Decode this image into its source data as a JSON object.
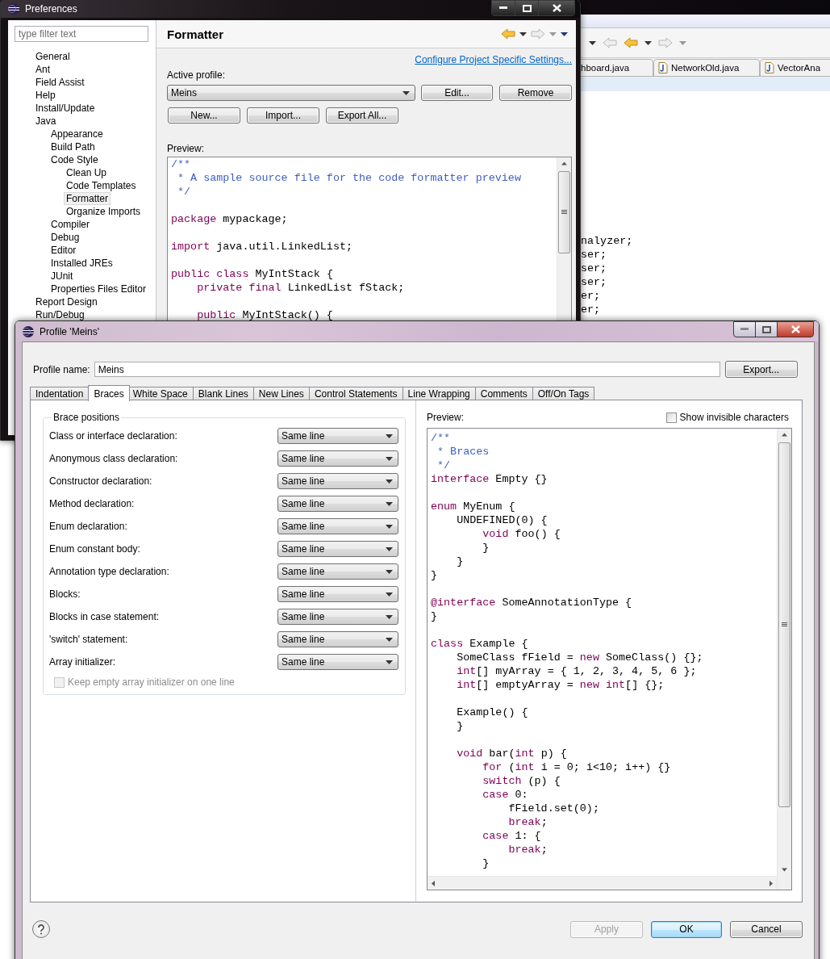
{
  "ide_background": {
    "editor_tabs": [
      {
        "label": "hboard.java",
        "selected": false
      },
      {
        "label": "NetworkOld.java",
        "selected": false
      },
      {
        "label": "VectorAna",
        "selected": false
      }
    ],
    "code_lines": [
      "nalyzer;",
      "ser;",
      "ser;",
      "ser;",
      "er;",
      "er;"
    ]
  },
  "preferences": {
    "title": "Preferences",
    "filter_placeholder": "type filter text",
    "tree": [
      {
        "label": "General",
        "selected": false
      },
      {
        "label": "Ant",
        "selected": false
      },
      {
        "label": "Field Assist",
        "selected": false
      },
      {
        "label": "Help",
        "selected": false
      },
      {
        "label": "Install/Update",
        "selected": false
      },
      {
        "label": "Java",
        "selected": false,
        "children": [
          {
            "label": "Appearance",
            "selected": false
          },
          {
            "label": "Build Path",
            "selected": false
          },
          {
            "label": "Code Style",
            "selected": false,
            "children": [
              {
                "label": "Clean Up",
                "selected": false
              },
              {
                "label": "Code Templates",
                "selected": false
              },
              {
                "label": "Formatter",
                "selected": true
              },
              {
                "label": "Organize Imports",
                "selected": false
              }
            ]
          },
          {
            "label": "Compiler",
            "selected": false
          },
          {
            "label": "Debug",
            "selected": false
          },
          {
            "label": "Editor",
            "selected": false
          },
          {
            "label": "Installed JREs",
            "selected": false
          },
          {
            "label": "JUnit",
            "selected": false
          },
          {
            "label": "Properties Files Editor",
            "selected": false
          }
        ]
      },
      {
        "label": "Report Design",
        "selected": false
      },
      {
        "label": "Run/Debug",
        "selected": false
      }
    ],
    "page_title": "Formatter",
    "link": "Configure Project Specific Settings...",
    "active_profile_label": "Active profile:",
    "active_profile": "Meins",
    "profile_actions": [
      "Edit...",
      "Remove"
    ],
    "profile_buttons": [
      "New...",
      "Import...",
      "Export All..."
    ],
    "preview_label": "Preview:",
    "preview_lines": [
      {
        "kind": "comment",
        "text": "/**"
      },
      {
        "kind": "comment",
        "text": " * A sample source file for the code formatter preview"
      },
      {
        "kind": "comment",
        "text": " */"
      },
      {
        "kind": "blank"
      },
      {
        "kind": "code",
        "text": "**package** mypackage;"
      },
      {
        "kind": "blank"
      },
      {
        "kind": "code",
        "text": "**import** java.util.LinkedList;"
      },
      {
        "kind": "blank"
      },
      {
        "kind": "code",
        "text": "**public** **class** MyIntStack {"
      },
      {
        "kind": "code",
        "text": "    **private** **final** LinkedList fStack;"
      },
      {
        "kind": "blank"
      },
      {
        "kind": "code",
        "text": "    **public** MyIntStack() {"
      }
    ]
  },
  "dialog": {
    "title": "Profile 'Meins'",
    "profile_name_label": "Profile name:",
    "profile_name": "Meins",
    "export_button": "Export...",
    "tabs": [
      {
        "label": "Indentation",
        "selected": false
      },
      {
        "label": "Braces",
        "selected": true
      },
      {
        "label": "White Space",
        "selected": false
      },
      {
        "label": "Blank Lines",
        "selected": false
      },
      {
        "label": "New Lines",
        "selected": false
      },
      {
        "label": "Control Statements",
        "selected": false
      },
      {
        "label": "Line Wrapping",
        "selected": false
      },
      {
        "label": "Comments",
        "selected": false
      },
      {
        "label": "Off/On Tags",
        "selected": false
      }
    ],
    "group_title": "Brace positions",
    "settings": [
      {
        "label": "Class or interface declaration:",
        "value": "Same line"
      },
      {
        "label": "Anonymous class declaration:",
        "value": "Same line"
      },
      {
        "label": "Constructor declaration:",
        "value": "Same line"
      },
      {
        "label": "Method declaration:",
        "value": "Same line"
      },
      {
        "label": "Enum declaration:",
        "value": "Same line"
      },
      {
        "label": "Enum constant body:",
        "value": "Same line"
      },
      {
        "label": "Annotation type declaration:",
        "value": "Same line"
      },
      {
        "label": "Blocks:",
        "value": "Same line"
      },
      {
        "label": "Blocks in case statement:",
        "value": "Same line"
      },
      {
        "label": "'switch' statement:",
        "value": "Same line"
      },
      {
        "label": "Array initializer:",
        "value": "Same line"
      }
    ],
    "keep_empty": {
      "label": "Keep empty array initializer on one line",
      "checked": false,
      "disabled": true
    },
    "preview_label": "Preview:",
    "show_invisible": {
      "label": "Show invisible characters",
      "checked": false
    },
    "preview_lines": [
      {
        "kind": "comment",
        "text": "/**"
      },
      {
        "kind": "comment",
        "text": " * Braces"
      },
      {
        "kind": "comment",
        "text": " */"
      },
      {
        "kind": "code",
        "text": "**interface** Empty {}"
      },
      {
        "kind": "blank"
      },
      {
        "kind": "code",
        "text": "**enum** MyEnum {"
      },
      {
        "kind": "code",
        "text": "    UNDEFINED(0) {"
      },
      {
        "kind": "code",
        "text": "        **void** foo() {"
      },
      {
        "kind": "code",
        "text": "        }"
      },
      {
        "kind": "code",
        "text": "    }"
      },
      {
        "kind": "code",
        "text": "}"
      },
      {
        "kind": "blank"
      },
      {
        "kind": "code",
        "text": "**@interface** SomeAnnotationType {"
      },
      {
        "kind": "code",
        "text": "}"
      },
      {
        "kind": "blank"
      },
      {
        "kind": "code",
        "text": "**class** Example {"
      },
      {
        "kind": "code",
        "text": "    SomeClass fField = **new** SomeClass() {};"
      },
      {
        "kind": "code",
        "text": "    **int**[] myArray = { 1, 2, 3, 4, 5, 6 };"
      },
      {
        "kind": "code",
        "text": "    **int**[] emptyArray = **new** **int**[] {};"
      },
      {
        "kind": "blank"
      },
      {
        "kind": "code",
        "text": "    Example() {"
      },
      {
        "kind": "code",
        "text": "    }"
      },
      {
        "kind": "blank"
      },
      {
        "kind": "code",
        "text": "    **void** bar(**int** p) {"
      },
      {
        "kind": "code",
        "text": "        **for** (**int** i = 0; i<10; i++) {}"
      },
      {
        "kind": "code",
        "text": "        **switch** (p) {"
      },
      {
        "kind": "code",
        "text": "        **case** 0:"
      },
      {
        "kind": "code",
        "text": "            fField.set(0);"
      },
      {
        "kind": "code",
        "text": "            **break**;"
      },
      {
        "kind": "code",
        "text": "        **case** 1: {"
      },
      {
        "kind": "code",
        "text": "            **break**;"
      },
      {
        "kind": "code",
        "text": "        }"
      }
    ],
    "buttons": [
      {
        "label": "Apply",
        "disabled": true,
        "default": false
      },
      {
        "label": "OK",
        "disabled": false,
        "default": true
      },
      {
        "label": "Cancel",
        "disabled": false,
        "default": false
      }
    ]
  }
}
